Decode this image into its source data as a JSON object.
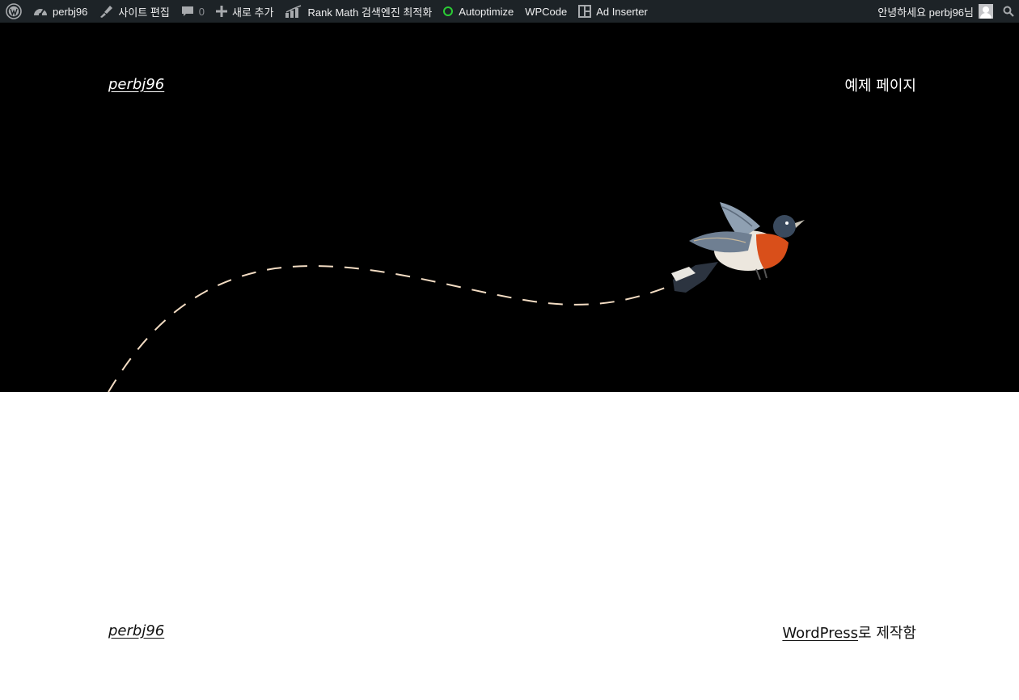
{
  "adminbar": {
    "site_name": "perbj96",
    "edit_site": "사이트 편집",
    "comments_count": "0",
    "new_content": "새로 추가",
    "rank_math": "Rank Math 검색엔진 최적화",
    "autoptimize": "Autoptimize",
    "wpcode": "WPCode",
    "ad_inserter": "Ad Inserter",
    "greeting": "안녕하세요 perbj96님",
    "icons": [
      "wordpress-logo-icon",
      "dashboard-icon",
      "brush-icon",
      "comment-icon",
      "plus-icon",
      "rank-math-chart-icon",
      "ring-icon",
      "ad-inserter-icon",
      "avatar",
      "search-icon"
    ]
  },
  "header": {
    "site_title": "perbj96",
    "nav_item": "예제 페이지"
  },
  "footer": {
    "site_title": "perbj96",
    "credit_link": "WordPress",
    "credit_suffix": "로 제작함"
  },
  "colors": {
    "adminbar_bg": "#1d2327",
    "hero_bg": "#000000",
    "trail": "#f3dcc3",
    "ring_green": "#2bcc35"
  }
}
